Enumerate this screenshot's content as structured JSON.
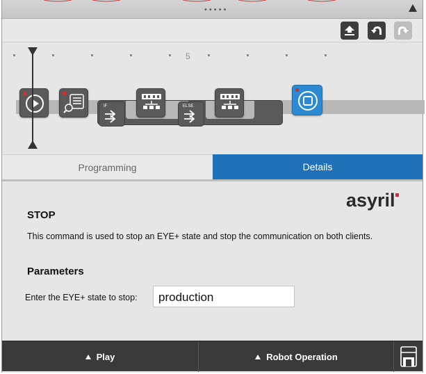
{
  "toolbar": {
    "upload_icon": "upload-icon",
    "undo_icon": "undo-icon",
    "redo_icon": "redo-icon"
  },
  "timeline": {
    "step_marker": "5",
    "blocks": [
      {
        "name": "start",
        "icon": "play-icon"
      },
      {
        "name": "vision-search",
        "icon": "search-list-icon"
      },
      {
        "name": "if",
        "label": "IF",
        "icon": "branch-icon"
      },
      {
        "name": "group-1",
        "icon": "hierarchy-icon"
      },
      {
        "name": "else",
        "label": "ELSE",
        "icon": "branch-icon"
      },
      {
        "name": "group-2",
        "icon": "hierarchy-icon"
      },
      {
        "name": "stop",
        "icon": "stop-icon"
      }
    ]
  },
  "tabs": {
    "programming": "Programming",
    "details": "Details",
    "active": "details"
  },
  "details": {
    "logo": "asyril",
    "command_title": "STOP",
    "description": "This command is used to stop an EYE+ state and stop the communication on both clients.",
    "parameters_title": "Parameters",
    "param_label": "Enter the EYE+ state to stop:",
    "param_value": "production"
  },
  "bottom_bar": {
    "play_label": "Play",
    "robot_operation_label": "Robot Operation",
    "save_icon": "save-icon"
  },
  "colors": {
    "accent": "#1f72b8",
    "block": "#5a5a5a",
    "stop_block": "#2b8ad1",
    "bottom_bar": "#3a3a3a"
  }
}
